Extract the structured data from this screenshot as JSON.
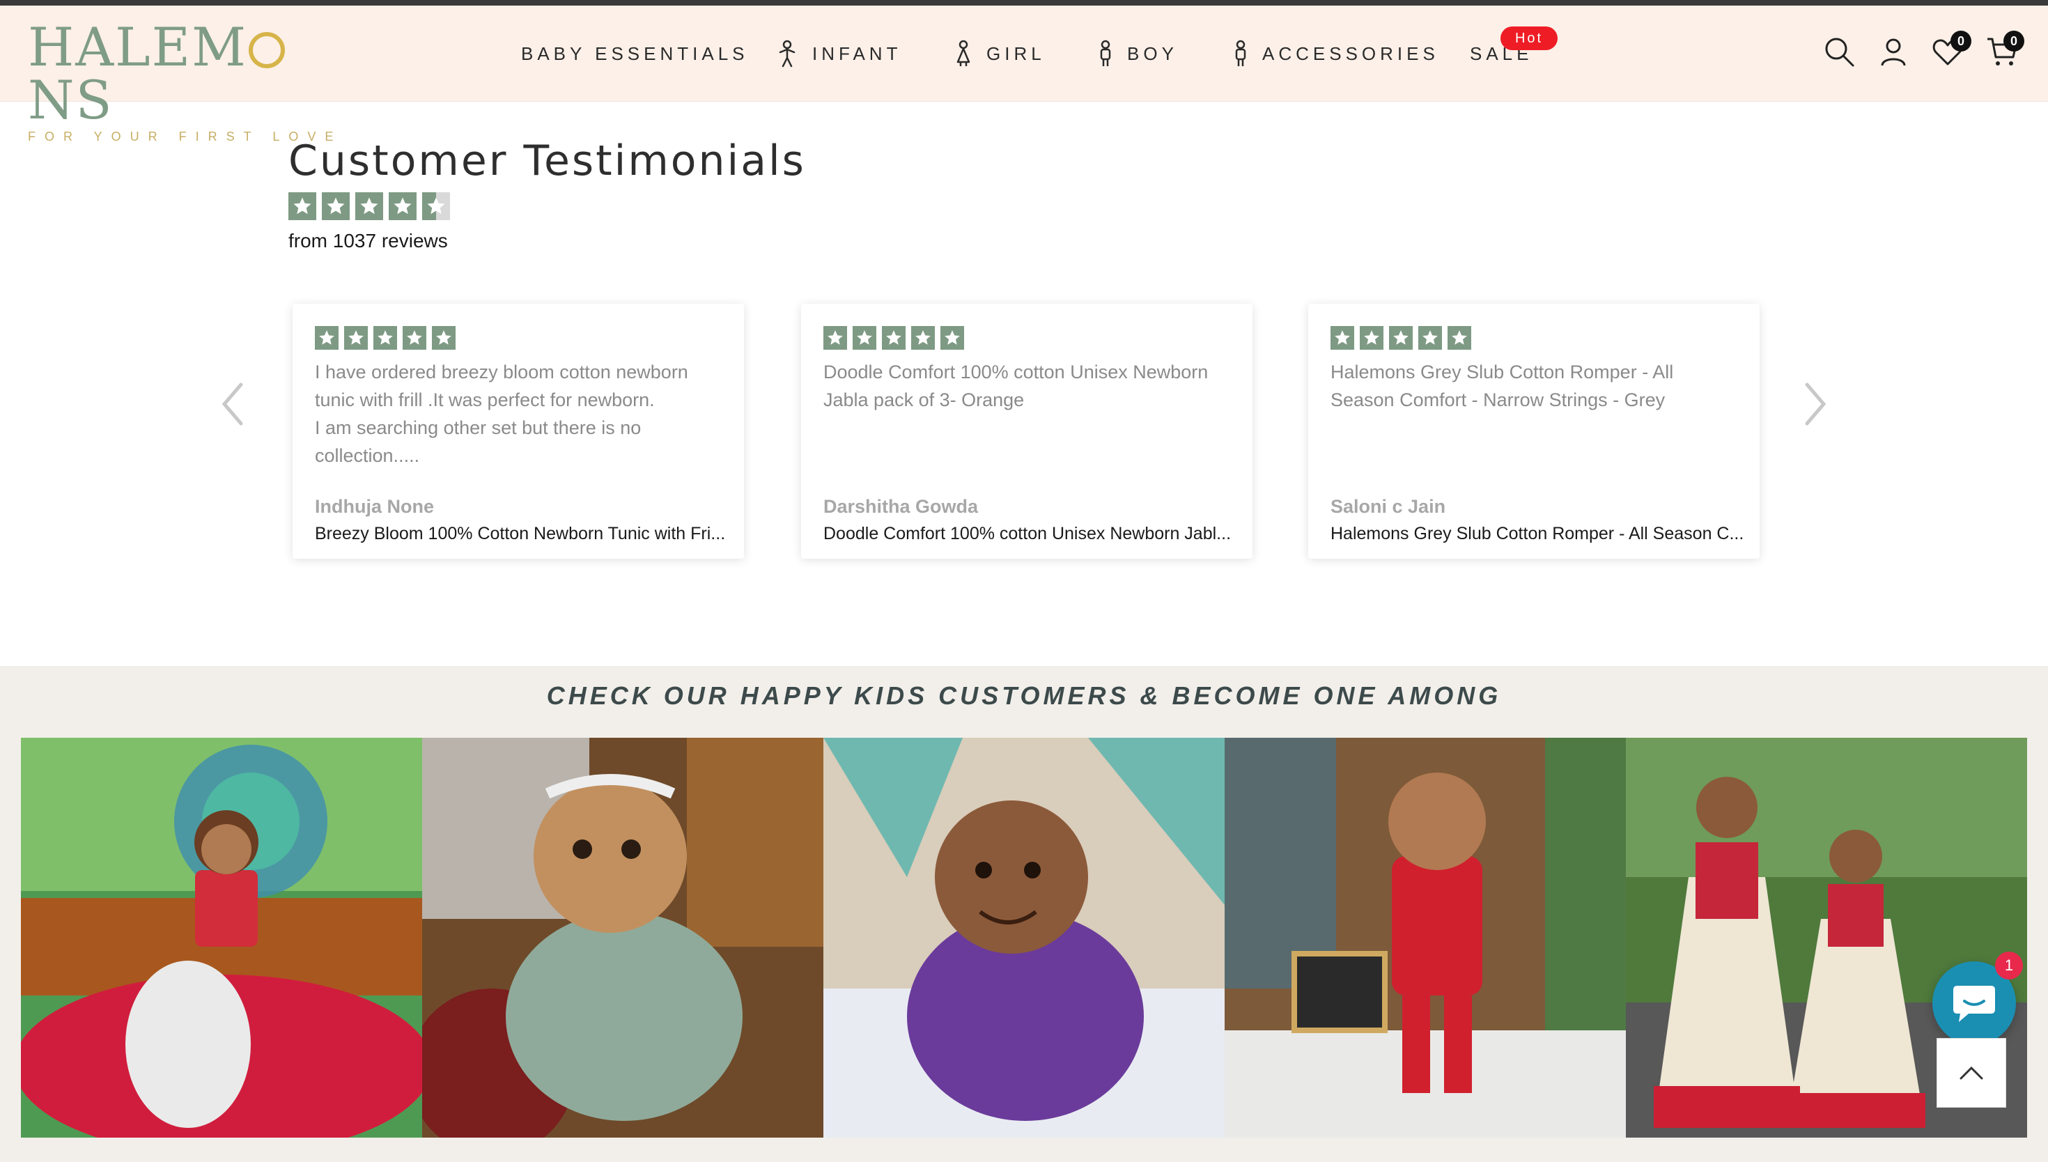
{
  "brand": {
    "name": "HALEMONS",
    "tagline": "FOR YOUR FIRST LOVE",
    "colors": {
      "primary": "#7f9c86",
      "gold": "#c7ad64",
      "header_bg": "#fcf0e8"
    }
  },
  "nav": {
    "items": [
      {
        "label": "BABY ESSENTIALS",
        "icon": ""
      },
      {
        "label": "INFANT",
        "icon": "infant-icon"
      },
      {
        "label": "GIRL",
        "icon": "girl-icon"
      },
      {
        "label": "BOY",
        "icon": "boy-icon"
      },
      {
        "label": "ACCESSORIES",
        "icon": "accessories-icon"
      },
      {
        "label": "SALE",
        "icon": ""
      }
    ],
    "sale_badge": "Hot"
  },
  "header_actions": {
    "wishlist_count": "0",
    "cart_count": "0"
  },
  "testimonials": {
    "title": "Customer Testimonials",
    "rating": 4.5,
    "summary": "from 1037 reviews",
    "cards": [
      {
        "rating": 5,
        "text": "I have ordered breezy bloom cotton newborn tunic with frill .It was perfect for newborn.\nI am searching other set but there is no collection.....",
        "author": "Indhuja None",
        "product": "Breezy Bloom 100% Cotton Newborn Tunic with Fri..."
      },
      {
        "rating": 5,
        "text": "Doodle Comfort 100% cotton Unisex Newborn Jabla pack of 3- Orange",
        "author": "Darshitha Gowda",
        "product": "Doodle Comfort 100% cotton Unisex Newborn Jabl..."
      },
      {
        "rating": 5,
        "text": "Halemons Grey Slub Cotton Romper - All Season Comfort - Narrow Strings - Grey",
        "author": "Saloni c Jain",
        "product": "Halemons Grey Slub Cotton Romper - All Season C..."
      }
    ]
  },
  "kids_section": {
    "title": "CHECK OUR HAPPY KIDS CUSTOMERS & BECOME ONE AMONG",
    "photos": [
      {
        "note": "girl-in-red-lehenga-peacock"
      },
      {
        "note": "baby-floral-dress-headband"
      },
      {
        "note": "baby-purple-ruffle-top"
      },
      {
        "note": "baby-red-romper-7-months"
      },
      {
        "note": "two-girls-lehenga-outdoor"
      }
    ],
    "chat_badge": "1"
  }
}
